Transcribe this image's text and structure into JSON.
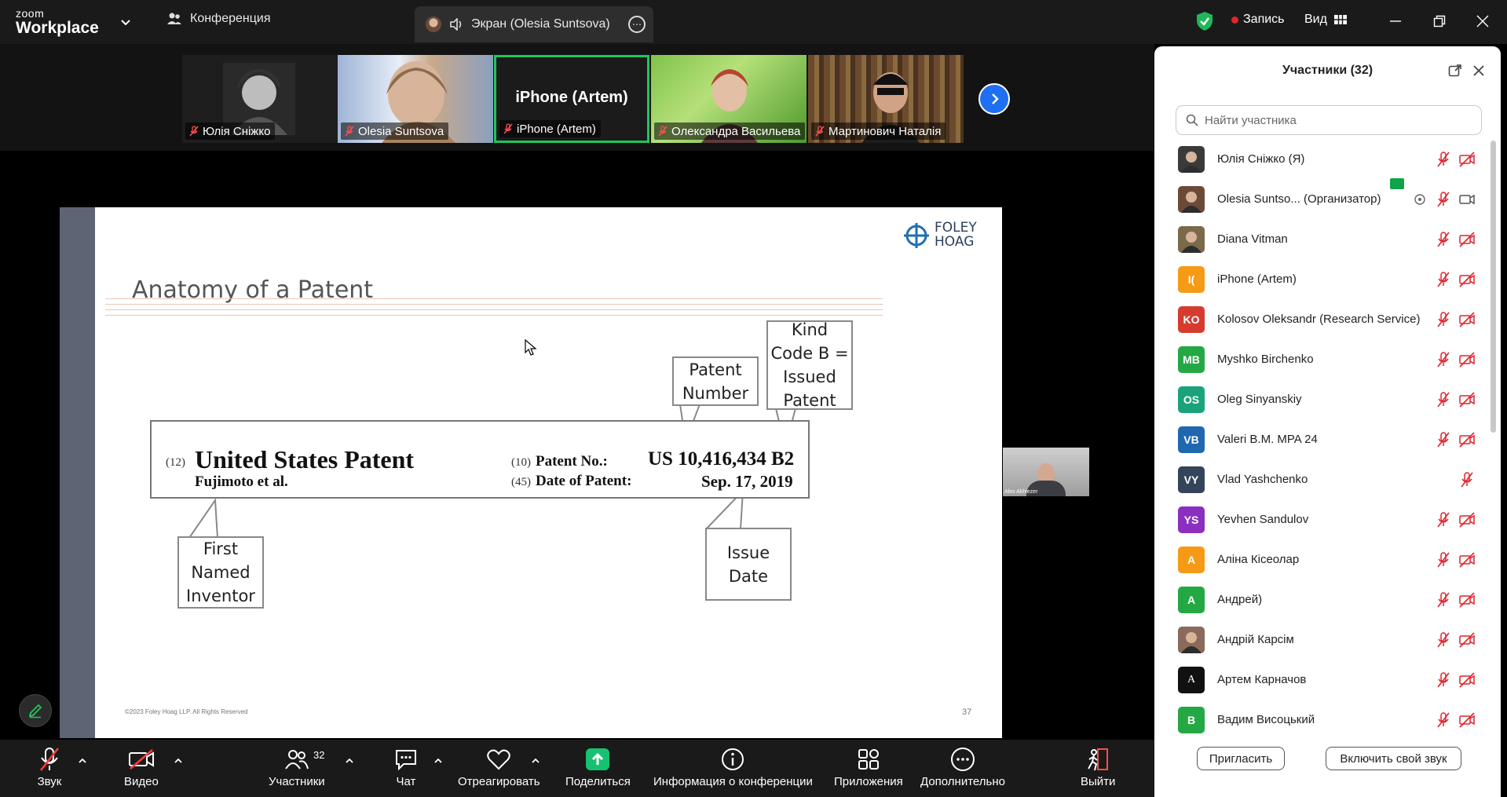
{
  "app": {
    "brand_small": "zoom",
    "brand_big": "Workplace",
    "conference_label": "Конференция",
    "screen_tab_label": "Экран (Olesia Suntsova)",
    "record_label": "Запись",
    "view_label": "Вид"
  },
  "thumbnails": [
    {
      "name": "Юлія Сніжко",
      "muted": true
    },
    {
      "name": "Olesia Suntsova",
      "muted": true
    },
    {
      "name": "iPhone (Artem)",
      "center_text": "iPhone (Artem)",
      "muted": true,
      "active": true
    },
    {
      "name": "Олександра Васильева",
      "muted": true
    },
    {
      "name": "Мартинович Наталія",
      "muted": true
    }
  ],
  "slide": {
    "title": "Anatomy of a Patent",
    "logo_line1": "FOLEY",
    "logo_line2": "HOAG",
    "patent": {
      "code12": "(12)",
      "heading": "United States Patent",
      "inventor": "Fujimoto et al.",
      "code10": "(10)",
      "patent_no_label": "Patent No.:",
      "patent_no_value": "US 10,416,434 B2",
      "code45": "(45)",
      "date_label": "Date of Patent:",
      "date_value": "Sep. 17, 2019"
    },
    "callouts": {
      "patent_number": "Patent\nNumber",
      "kind_code": "Kind\nCode B =\nIssued\nPatent",
      "first_inventor": "First\nNamed\nInventor",
      "issue_date": "Issue\nDate"
    },
    "footer": "©2023 Foley Hoag LLP. All Rights Reserved",
    "page_number": "37",
    "mini_video_caption": "Alex Akhiezer"
  },
  "toolbar": {
    "audio": "Звук",
    "video": "Видео",
    "participants": "Участники",
    "participants_count": "32",
    "chat": "Чат",
    "react": "Отреагировать",
    "share": "Поделиться",
    "info": "Информация о конференции",
    "apps": "Приложения",
    "more": "Дополнительно",
    "leave": "Выйти"
  },
  "panel": {
    "title": "Участники (32)",
    "search_placeholder": "Найти участника",
    "invite_button": "Пригласить",
    "unmute_self_button": "Включить свой звук",
    "participants": [
      {
        "initials": "",
        "name": "Юлія Сніжко (Я)",
        "color": "#3a3a3a",
        "photo": true,
        "video_off": true
      },
      {
        "initials": "",
        "name": "Olesia Suntso... (Организатор)",
        "color": "#6b4a38",
        "photo": true,
        "video_off": false,
        "host": true
      },
      {
        "initials": "",
        "name": "Diana Vitman",
        "color": "#7a6a4a",
        "photo": true,
        "video_off": true
      },
      {
        "initials": "I(",
        "name": "iPhone (Artem)",
        "color": "#f59a14",
        "video_off": true
      },
      {
        "initials": "KO",
        "name": "Kolosov Oleksandr (Research Service)",
        "color": "#d63b2f",
        "video_off": true
      },
      {
        "initials": "MB",
        "name": "Myshko Birchenko",
        "color": "#24a844",
        "video_off": true
      },
      {
        "initials": "OS",
        "name": "Oleg Sinyanskiy",
        "color": "#1aa37a",
        "video_off": true
      },
      {
        "initials": "VB",
        "name": "Valeri B.M. MPA 24",
        "color": "#1f67b0",
        "video_off": true
      },
      {
        "initials": "VY",
        "name": "Vlad Yashchenko",
        "color": "#34445a",
        "video_off": false,
        "no_video_icon": true
      },
      {
        "initials": "YS",
        "name": "Yevhen Sandulov",
        "color": "#8a2fc0",
        "video_off": true
      },
      {
        "initials": "A",
        "name": "Аліна Кісеолар",
        "color": "#f59a14",
        "video_off": true
      },
      {
        "initials": "A",
        "name": "Андрей)",
        "color": "#24a844",
        "video_off": true
      },
      {
        "initials": "",
        "name": "Андрій Карсім",
        "color": "#8a6a5a",
        "photo": true,
        "video_off": true
      },
      {
        "initials": "A",
        "name": "Артем Карначов",
        "color": "#111111",
        "video_off": true,
        "serif": true
      },
      {
        "initials": "B",
        "name": "Вадим Висоцький",
        "color": "#24a844",
        "video_off": true
      }
    ]
  }
}
